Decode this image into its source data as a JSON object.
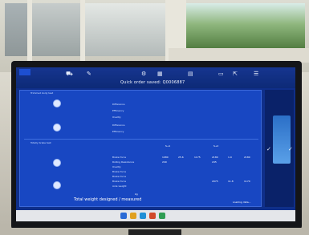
{
  "window_title": "Quick order saved: Q0006887",
  "sections": {
    "first": "Trimmed body test",
    "second": "Totally brake test"
  },
  "row_labels_first": [
    "Difference",
    "Efficiency",
    "Ovality",
    "Difference",
    "Efficiency"
  ],
  "row_labels_second": [
    "Brake force",
    "Rolling Resistance",
    "Ovality",
    "Brake force",
    "Brake force",
    "Brake force",
    "Axle weight"
  ],
  "totals_label": "Total weight designed / measured",
  "total_unit": "kg",
  "column_groups": [
    "S+1",
    "S+2"
  ],
  "values_second": [
    "1080",
    "25.6",
    "1175",
    "2180",
    "1.9",
    "2180",
    "240",
    "245",
    "2975",
    "11.8",
    "1170"
  ],
  "icons": [
    "car-icon",
    "wrench-icon",
    "gear-icon",
    "garage-icon",
    "printer-icon",
    "document-icon"
  ],
  "footer_text": "Loading data...",
  "status_checks": [
    "check",
    "check"
  ]
}
